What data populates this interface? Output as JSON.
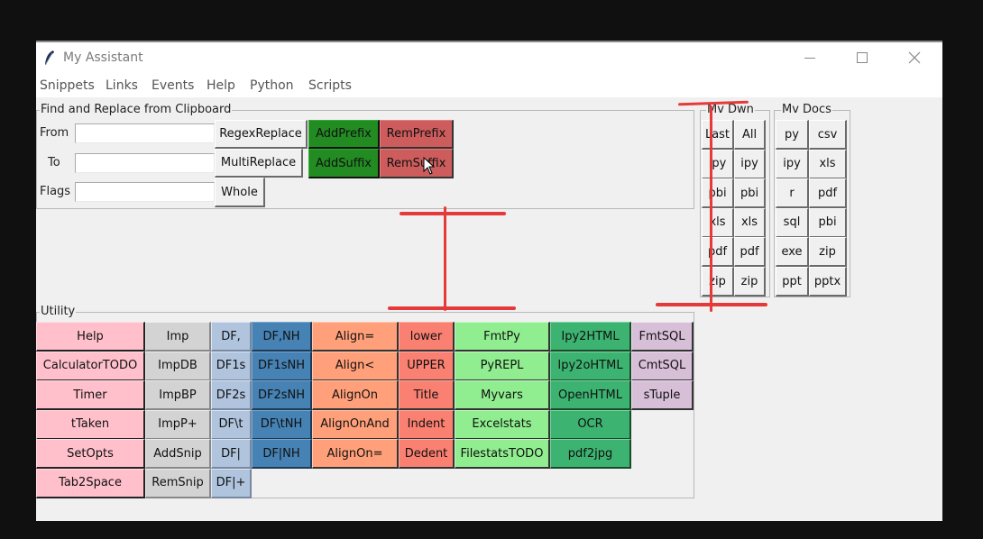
{
  "window": {
    "title": "My Assistant",
    "controls": {
      "minimize": "minimize-icon",
      "maximize": "maximize-icon",
      "close": "close-icon"
    }
  },
  "menubar": [
    "Snippets",
    "Links",
    "Events",
    "Help",
    "Python",
    "Scripts"
  ],
  "find_replace": {
    "title": "Find and Replace from Clipboard",
    "fields": [
      {
        "label": "From",
        "value": "",
        "placeholder": ""
      },
      {
        "label": "To",
        "value": "",
        "placeholder": ""
      },
      {
        "label": "Flags",
        "value": "",
        "placeholder": ""
      }
    ],
    "buttons": {
      "regex_replace": "RegexReplace",
      "multi_replace": "MultiReplace",
      "whole": "Whole",
      "add_prefix": "AddPrefix",
      "rem_prefix": "RemPrefix",
      "add_suffix": "AddSuffix",
      "rem_suffix": "RemSuffix"
    }
  },
  "mv_dwn": {
    "title": "Mv Dwn",
    "rows": [
      [
        "Last",
        "All"
      ],
      [
        "ipy",
        "ipy"
      ],
      [
        "pbi",
        "pbi"
      ],
      [
        "xls",
        "xls"
      ],
      [
        "pdf",
        "pdf"
      ],
      [
        "zip",
        "zip"
      ]
    ]
  },
  "mv_docs": {
    "title": "Mv Docs",
    "rows": [
      [
        "py",
        "csv"
      ],
      [
        "ipy",
        "xls"
      ],
      [
        "r",
        "pdf"
      ],
      [
        "sql",
        "pbi"
      ],
      [
        "exe",
        "zip"
      ],
      [
        "ppt",
        "pptx"
      ]
    ]
  },
  "utility": {
    "title": "Utility",
    "columns": [
      {
        "color": "#ffc0cb",
        "items": [
          "Help",
          "CalculatorTODO",
          "Timer",
          "tTaken",
          "SetOpts",
          "Tab2Space"
        ]
      },
      {
        "color": "#d3d3d3",
        "items": [
          "Imp",
          "ImpDB",
          "ImpBP",
          "ImpP+",
          "AddSnip",
          "RemSnip"
        ]
      },
      {
        "color": "#b0c4de",
        "items": [
          "DF,",
          "DF1s",
          "DF2s",
          "DF\\t",
          "DF|",
          "DF|+"
        ]
      },
      {
        "color": "#4682b4",
        "items": [
          "DF,NH",
          "DF1sNH",
          "DF2sNH",
          "DF\\tNH",
          "DF|NH"
        ]
      },
      {
        "color": "#ffa07a",
        "items": [
          "Align=",
          "Align<",
          "AlignOn",
          "AlignOnAnd",
          "AlignOn="
        ]
      },
      {
        "color": "#fa8072",
        "items": [
          "lower",
          "UPPER",
          "Title",
          "Indent",
          "Dedent"
        ]
      },
      {
        "color": "#90ee90",
        "items": [
          "FmtPy",
          "PyREPL",
          "Myvars",
          "Excelstats",
          "FilestatsTODO"
        ]
      },
      {
        "color": "#3cb371",
        "items": [
          "Ipy2HTML",
          "Ipy2oHTML",
          "OpenHTML",
          "OCR",
          "pdf2jpg"
        ]
      },
      {
        "color": "#d8bfd8",
        "items": [
          "FmtSQL",
          "CmtSQL",
          "sTuple"
        ]
      }
    ]
  },
  "colors": {
    "annotation": "#e63a3a",
    "add_button": "#228b22",
    "rem_button": "#cd5c5c"
  }
}
